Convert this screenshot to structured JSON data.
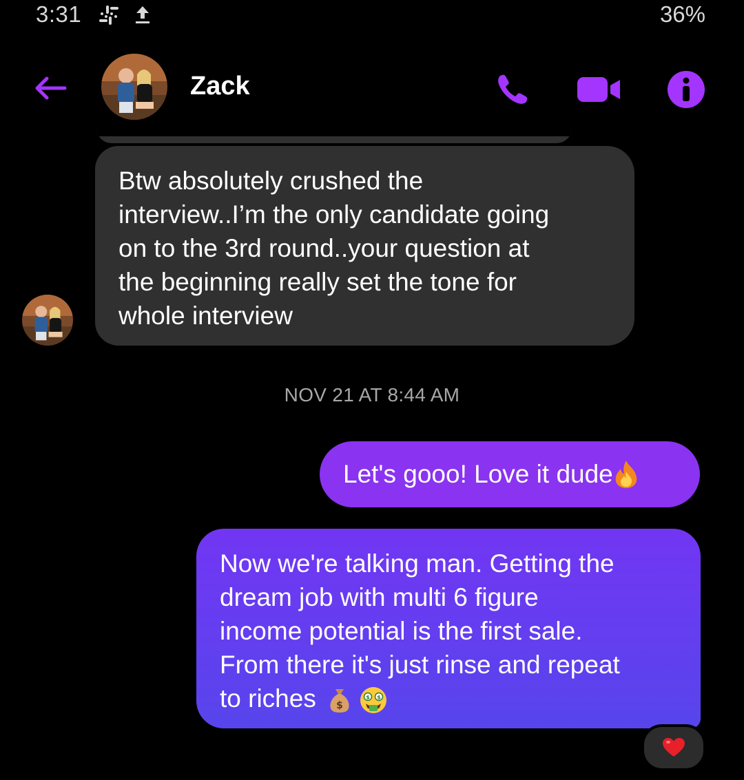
{
  "status_bar": {
    "time": "3:31",
    "battery": "36%",
    "icons": [
      "slack-icon",
      "upload-icon"
    ]
  },
  "header": {
    "contact_name": "Zack",
    "icons": [
      "back-arrow-icon",
      "phone-icon",
      "video-camera-icon",
      "info-icon"
    ],
    "accent_color": "#a335ff"
  },
  "messages": [
    {
      "direction": "incoming",
      "text": "Btw absolutely crushed the interview..I’m the only candidate going on to the 3rd round..your question at the beginning really set the tone for whole interview",
      "lines": [
        "Btw absolutely crushed the",
        "interview..I’m the only candidate going",
        "on to the 3rd round..your question at",
        "the beginning really set the tone for",
        "whole interview"
      ]
    },
    {
      "direction": "outgoing",
      "text": "Let's gooo! Love it dude",
      "emoji": "fire-emoji"
    },
    {
      "direction": "outgoing",
      "lines": [
        "Now we're talking man. Getting the",
        "dream job with multi 6 figure",
        "income potential is the first sale.",
        "From there it's just rinse and repeat",
        "to riches"
      ],
      "emoji": [
        "money-bag-emoji",
        "money-mouth-face-emoji"
      ],
      "reaction": "heart-emoji"
    }
  ],
  "timestamp": "NOV 21 AT 8:44 AM",
  "colors": {
    "background": "#000000",
    "incoming_bubble": "#303030",
    "outgoing_bubble_1": "#8a33f0",
    "outgoing_bubble_2_top": "#7236f3",
    "outgoing_bubble_2_bottom": "#5745ec"
  }
}
